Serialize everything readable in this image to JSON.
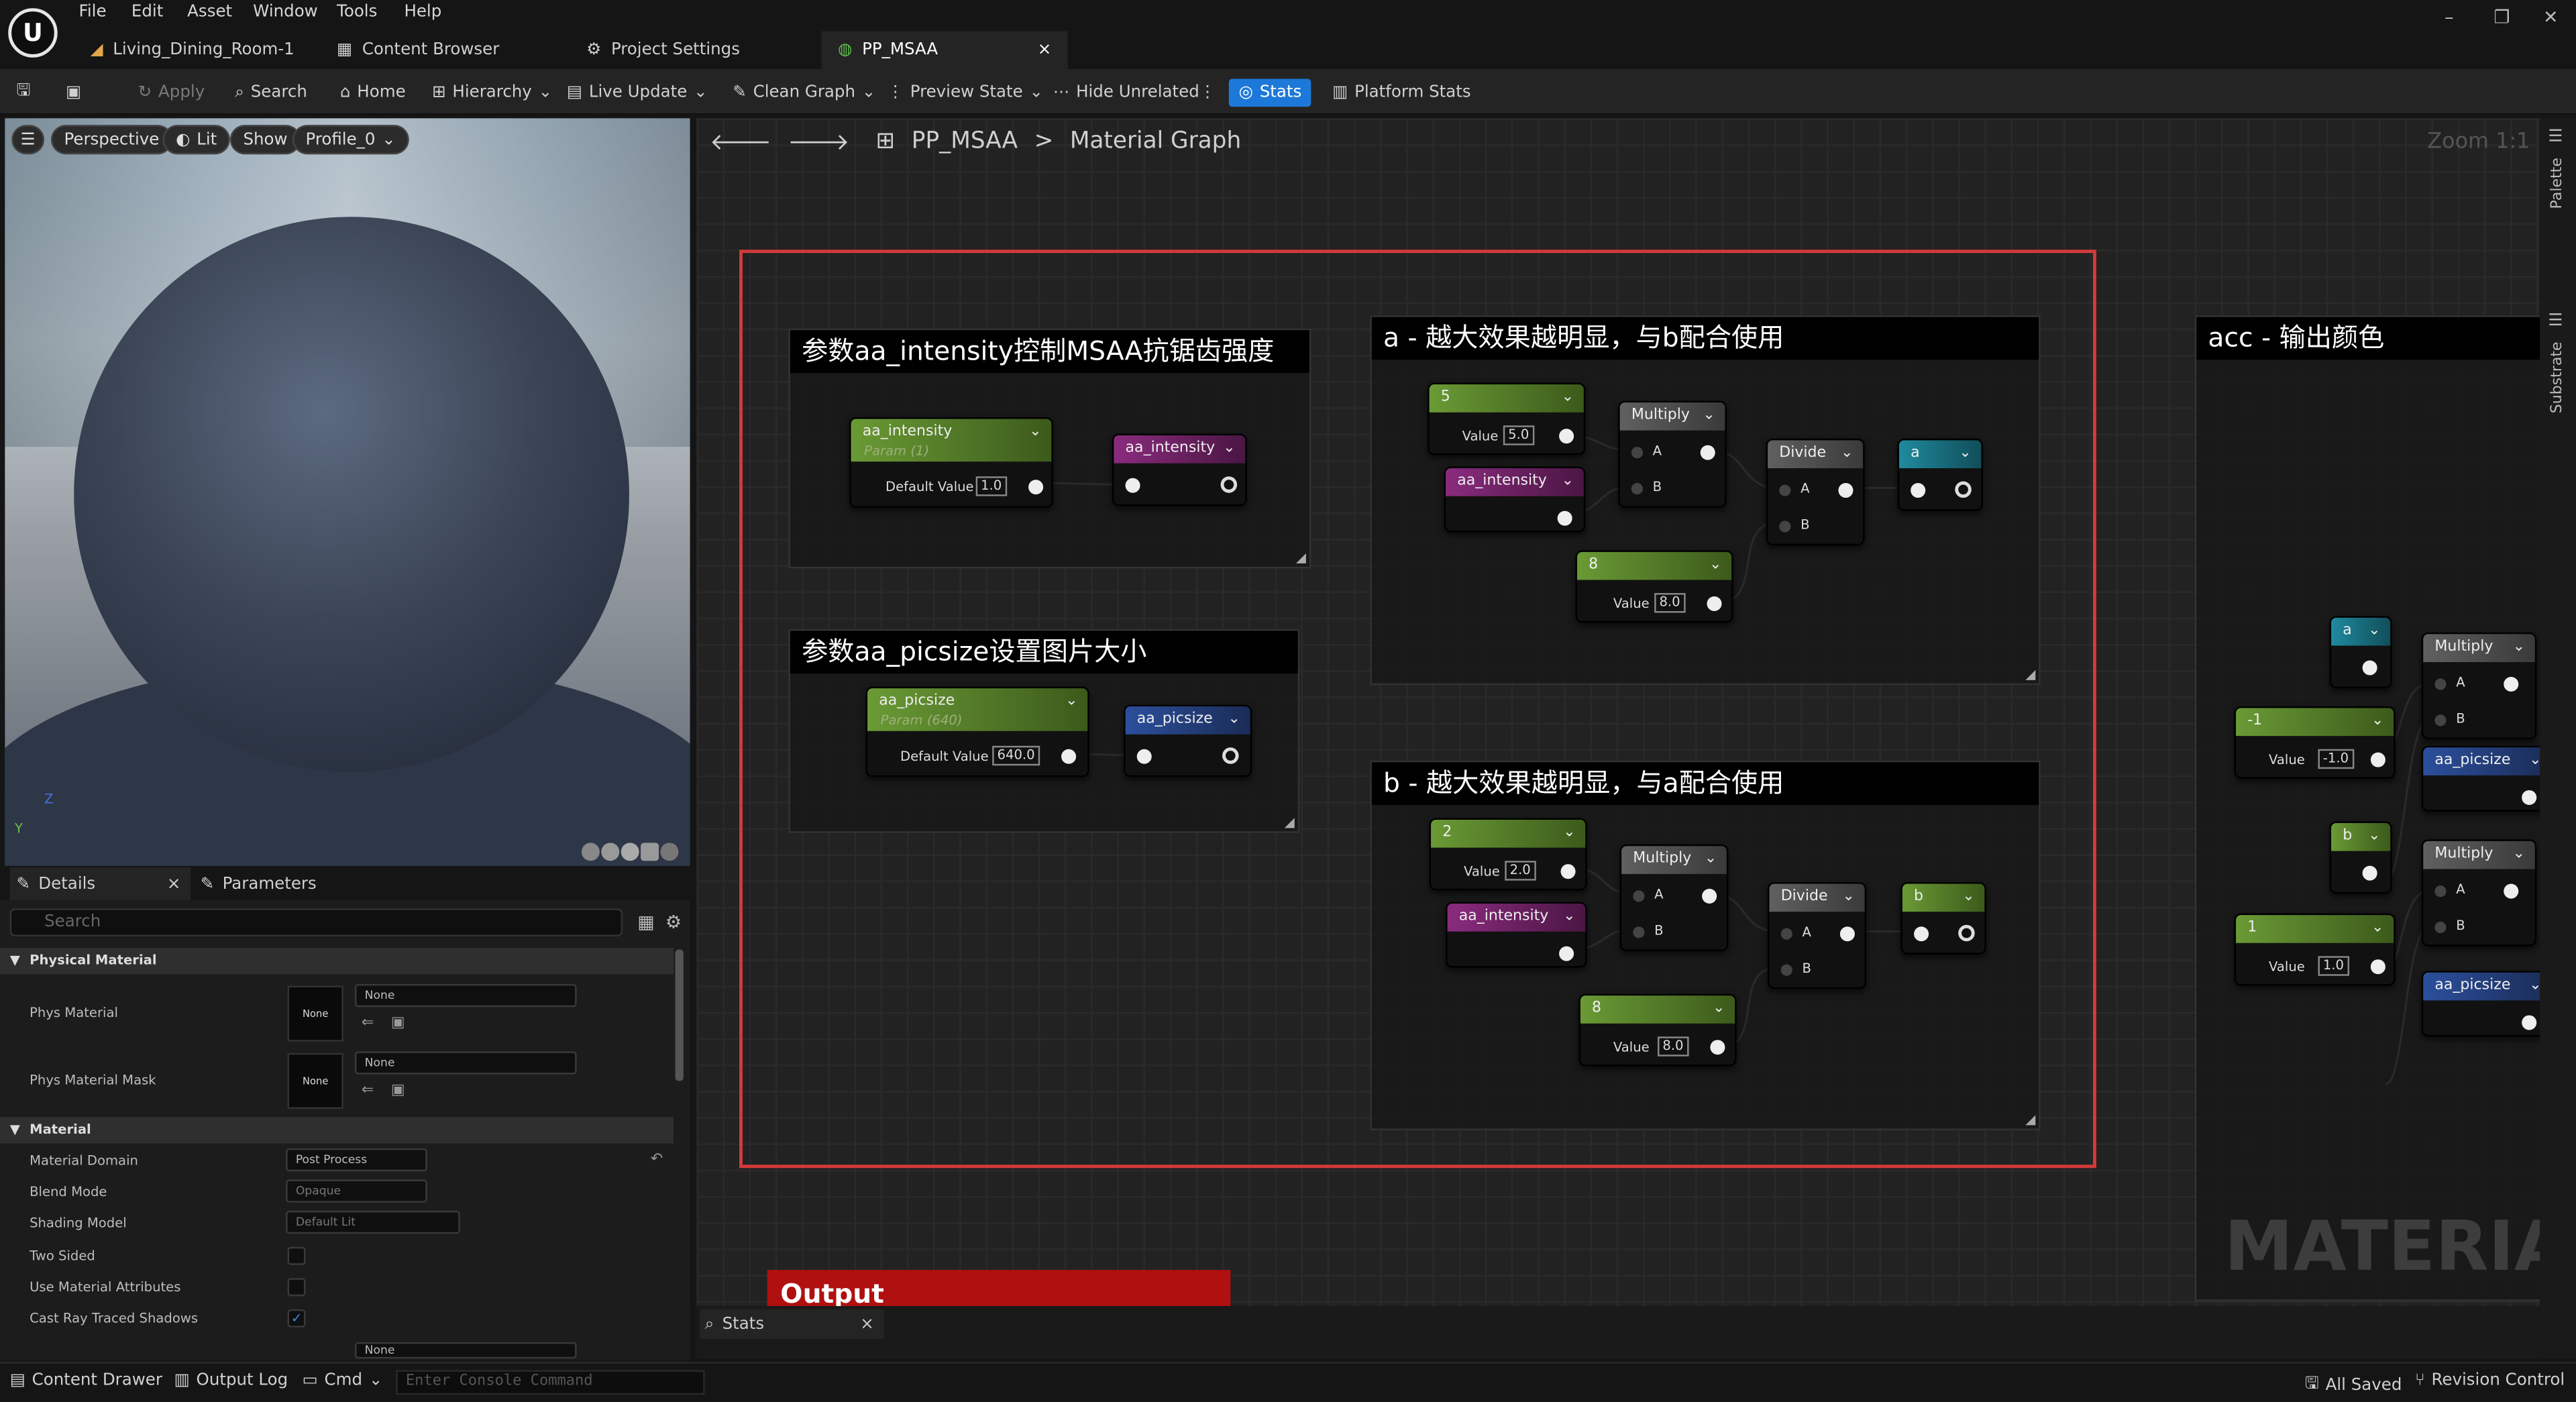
{
  "menu": {
    "items": [
      "File",
      "Edit",
      "Asset",
      "Window",
      "Tools",
      "Help"
    ]
  },
  "tabs": [
    {
      "label": "Living_Dining_Room-1"
    },
    {
      "label": "Content Browser"
    },
    {
      "label": "Project Settings"
    },
    {
      "label": "PP_MSAA",
      "close": "×"
    }
  ],
  "window": {
    "minimize": "–",
    "maximize": "❐",
    "close": "✕"
  },
  "toolbar": {
    "apply": "Apply",
    "search": "Search",
    "home": "Home",
    "hierarchy": "Hierarchy",
    "live_update": "Live Update",
    "clean_graph": "Clean Graph",
    "preview_state": "Preview State",
    "hide_unrelated": "Hide Unrelated",
    "stats": "Stats",
    "platform_stats": "Platform Stats"
  },
  "viewport": {
    "perspective": "Perspective",
    "lit": "Lit",
    "show": "Show",
    "profile": "Profile_0",
    "axis_z": "Z",
    "axis_y": "Y"
  },
  "details": {
    "tab_details": "Details",
    "tab_close": "×",
    "tab_parameters": "Parameters",
    "search_placeholder": "Search",
    "cat_physical": "Physical Material",
    "phys_material": "Phys Material",
    "phys_material_mask": "Phys Material Mask",
    "none": "None",
    "cat_material": "Material",
    "material_domain": "Material Domain",
    "material_domain_value": "Post Process",
    "blend_mode": "Blend Mode",
    "blend_mode_value": "Opaque",
    "shading_model": "Shading Model",
    "shading_model_value": "Default Lit",
    "two_sided": "Two Sided",
    "use_material_attributes": "Use Material Attributes",
    "cast_ray_traced_shadows": "Cast Ray Traced Shadows",
    "check": "✓"
  },
  "graph": {
    "breadcrumb_root": "PP_MSAA",
    "breadcrumb_sep": ">",
    "breadcrumb_leaf": "Material Graph",
    "zoom": "Zoom 1:1",
    "watermark": "MATERIAL",
    "output_comment": "Output",
    "c1_title": "参数aa_intensity控制MSAA抗锯齿强度",
    "c2_title": "参数aa_picsize设置图片大小",
    "c3_title": "a - 越大效果越明显，与b配合使用",
    "c4_title": "b - 越大效果越明显，与a配合使用",
    "c5_title": "acc - 输出颜色",
    "n_aa_intensity": "aa_intensity",
    "n_param1": "Param (1)",
    "default_value": "Default Value",
    "v1": "1.0",
    "n_aa_picsize": "aa_picsize",
    "n_param640": "Param (640)",
    "v640": "640.0",
    "n5": "5",
    "value": "Value",
    "v5": "5.0",
    "multiply": "Multiply",
    "divide": "Divide",
    "pinA": "A",
    "pinB": "B",
    "n8": "8",
    "v8": "8.0",
    "out_a": "a",
    "out_b": "b",
    "n2": "2",
    "v2": "2.0",
    "nm1": "-1",
    "vm1": "-1.0",
    "n1": "1",
    "v1b": "1.0",
    "chev": "⌄"
  },
  "stats_tab": {
    "label": "Stats",
    "close": "×"
  },
  "right_sidebar": {
    "palette": "Palette",
    "substrate": "Substrate"
  },
  "statusbar": {
    "content_drawer": "Content Drawer",
    "output_log": "Output Log",
    "cmd": "Cmd",
    "console_placeholder": "Enter Console Command",
    "all_saved": "All Saved",
    "revision_control": "Revision Control"
  }
}
